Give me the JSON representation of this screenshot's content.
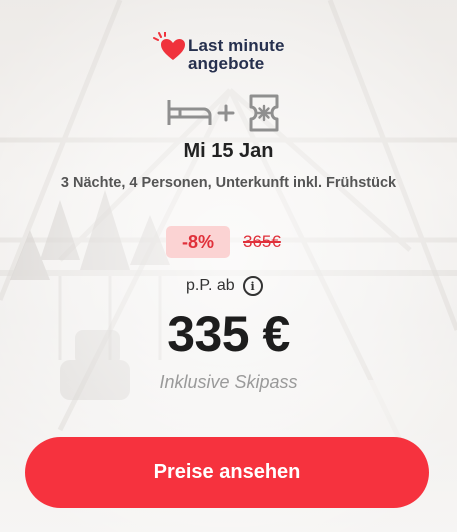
{
  "brand": {
    "line1": "Last minute",
    "line2": "angebote",
    "icon": "heart-icon",
    "heart_color": "#f0323c",
    "text_color": "#26304e"
  },
  "offer": {
    "icons": [
      "bed-icon",
      "plus-icon",
      "ticket-icon"
    ],
    "date": "Mi 15 Jan",
    "details": "3 Nächte, 4 Personen, Unterkunft inkl. Frühstück",
    "discount": "-8%",
    "old_price": "365€",
    "price_prefix": "p.P. ab",
    "info_icon": "info-icon",
    "info_glyph": "i",
    "price": "335 €",
    "includes": "Inklusive Skipass",
    "accent_color": "#e0303a"
  },
  "cta": {
    "label": "Preise ansehen",
    "color": "#f6323e"
  }
}
